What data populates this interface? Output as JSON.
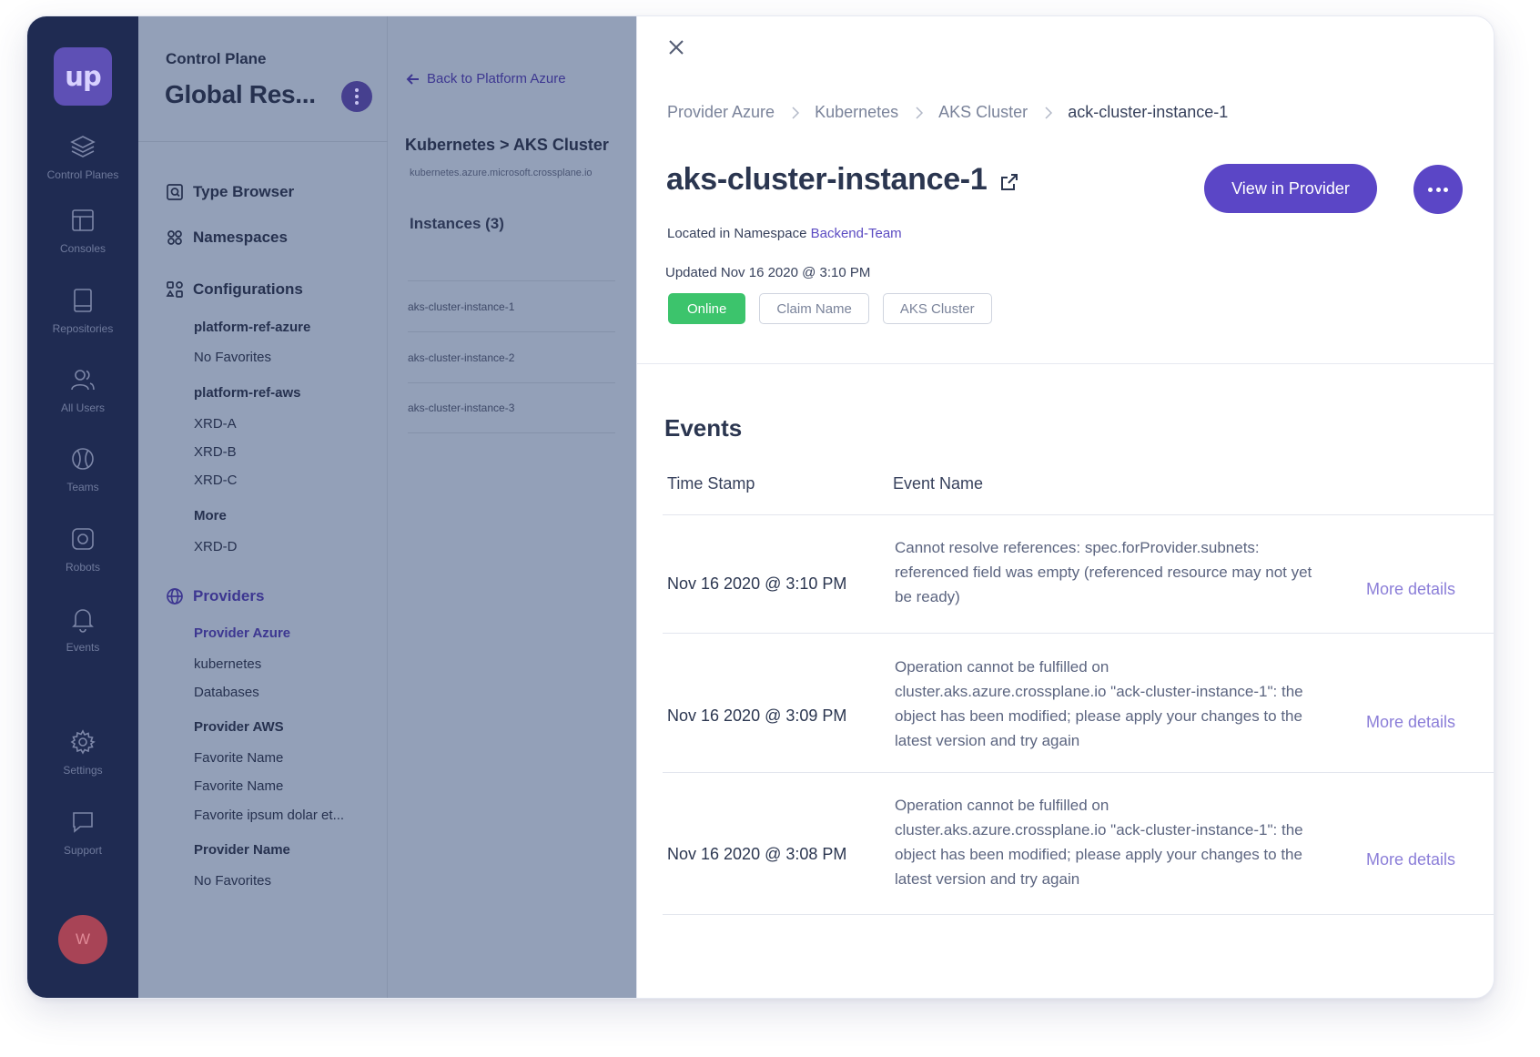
{
  "rail": {
    "logo": "up",
    "items": [
      {
        "label": "Control Planes",
        "icon": "layers-icon"
      },
      {
        "label": "Consoles",
        "icon": "layout-icon"
      },
      {
        "label": "Repositories",
        "icon": "book-icon"
      },
      {
        "label": "All Users",
        "icon": "users-icon"
      },
      {
        "label": "Teams",
        "icon": "ball-icon"
      },
      {
        "label": "Robots",
        "icon": "robot-icon"
      },
      {
        "label": "Events",
        "icon": "bell-icon"
      },
      {
        "label": "Settings",
        "icon": "gear-icon"
      },
      {
        "label": "Support",
        "icon": "chat-icon"
      }
    ],
    "avatar": "W"
  },
  "nav": {
    "context_label": "Control Plane",
    "context_title": "Global Res...",
    "type_browser": "Type Browser",
    "namespaces": "Namespaces",
    "configurations": {
      "label": "Configurations",
      "groups": [
        {
          "title": "platform-ref-azure",
          "items": [
            "No Favorites"
          ]
        },
        {
          "title": "platform-ref-aws",
          "items": [
            "XRD-A",
            "XRD-B",
            "XRD-C"
          ]
        },
        {
          "title": "More",
          "items": [
            "XRD-D"
          ]
        }
      ]
    },
    "providers": {
      "label": "Providers",
      "groups": [
        {
          "title": "Provider Azure",
          "items": [
            "kubernetes",
            "Databases"
          ]
        },
        {
          "title": "Provider AWS",
          "items": [
            "Favorite Name",
            "Favorite Name",
            "Favorite ipsum dolar et..."
          ]
        },
        {
          "title": "Provider Name",
          "items": [
            "No Favorites"
          ]
        }
      ]
    }
  },
  "instances": {
    "back_label": "Back to Platform Azure",
    "title": "Kubernetes > AKS Cluster",
    "subtitle": "kubernetes.azure.microsoft.crossplane.io",
    "count_label": "Instances (3)",
    "items": [
      "aks-cluster-instance-1",
      "aks-cluster-instance-2",
      "aks-cluster-instance-3"
    ]
  },
  "detail": {
    "breadcrumbs": [
      "Provider Azure",
      "Kubernetes",
      "AKS Cluster",
      "ack-cluster-instance-1"
    ],
    "title": "aks-cluster-instance-1",
    "namespace_prefix": "Located in Namespace ",
    "namespace": "Backend-Team",
    "updated": "Updated Nov 16 2020 @ 3:10 PM",
    "tags": [
      "Online",
      "Claim Name",
      "AKS Cluster"
    ],
    "view_button": "View in Provider",
    "status_color": "#3cc46c",
    "accent_color": "#5b46c6"
  },
  "events": {
    "title": "Events",
    "columns": [
      "Time Stamp",
      "Event Name"
    ],
    "rows": [
      {
        "timestamp": "Nov 16 2020 @ 3:10 PM",
        "message": "Cannot resolve references: spec.forProvider.subnets: referenced field was empty (referenced resource may not yet be ready)",
        "link": "More details"
      },
      {
        "timestamp": "Nov 16 2020 @ 3:09 PM",
        "message": "Operation cannot be fulfilled on cluster.aks.azure.crossplane.io \"ack-cluster-instance-1\": the object has been modified; please apply your changes to the latest version and try again",
        "link": "More details"
      },
      {
        "timestamp": "Nov 16 2020 @ 3:08 PM",
        "message": "Operation cannot be fulfilled on cluster.aks.azure.crossplane.io \"ack-cluster-instance-1\": the object has been modified; please apply your changes to the latest version and try again",
        "link": "More details"
      }
    ]
  }
}
